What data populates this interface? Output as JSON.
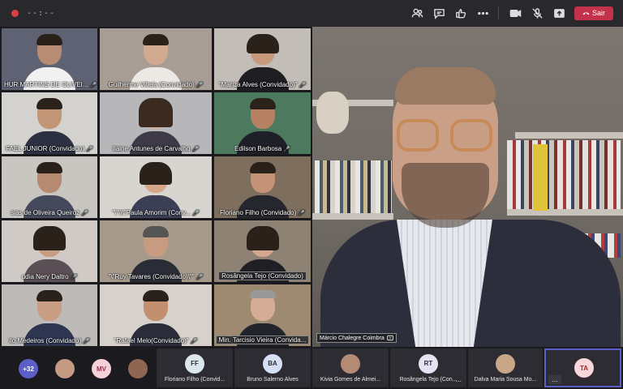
{
  "topbar": {
    "timer": "--:--",
    "leave_label": "Sair",
    "icons": [
      "participants-icon",
      "chat-icon",
      "reactions-icon",
      "more-icon",
      "camera-icon",
      "mic-off-icon",
      "share-icon"
    ]
  },
  "gallery": {
    "tiles": [
      {
        "name": "HUR MARTINS DE OLIVEI...",
        "mic": "🎤"
      },
      {
        "name": "Guilherme Villela (Convidado)",
        "mic": "🎤"
      },
      {
        "name": "\"Mariza Alves (Convidado)\"",
        "mic": "🎤"
      },
      {
        "name": "FAEL JUNIOR (Convidado)",
        "mic": "🎤"
      },
      {
        "name": "Ilaine Antunes de Carvalho",
        "mic": "🎤"
      },
      {
        "name": "Edilson Barbosa",
        "mic": "🎤"
      },
      {
        "name": "sias de Oliveira Queiroz",
        "mic": "🎤"
      },
      {
        "name": "\"\\\"\\\\\\\"Paula Amorim (Conv...",
        "mic": "🎤"
      },
      {
        "name": "Floriano Filho (Convidado)",
        "mic": "🎤"
      },
      {
        "name": "udia Nery Daltro",
        "mic": "🎤"
      },
      {
        "name": "\"\\\"Ruy Tavares (Convidado)\\\"\"",
        "mic": "🎤"
      },
      {
        "name": "Rosângela Tejo (Convidado)",
        "mic": ""
      },
      {
        "name": "ilo Medeiros (Convidado)",
        "mic": "🎤"
      },
      {
        "name": "\"Rafael Melo(Convidado)\"",
        "mic": "🎤"
      },
      {
        "name": "Min. Tarcisio Vieira (Convida...",
        "mic": ""
      }
    ]
  },
  "main": {
    "speaker_name": "Márcio Chalegre Coimbra"
  },
  "bottom": {
    "overflow_count": "+32",
    "initials_mv": "MV",
    "tiles": [
      {
        "initials": "FF",
        "name": "Floriano Filho (Convid..."
      },
      {
        "initials": "BA",
        "name": "Bruno Salerno Alves"
      },
      {
        "initials": "",
        "name": "Kivia Gomes de Almei..."
      },
      {
        "initials": "RT",
        "name": "Rosângela Tejo (Con..."
      },
      {
        "initials": "",
        "name": "Dalva Maria Sousa Mo..."
      }
    ],
    "more": "...",
    "ta_initials": "TA"
  }
}
